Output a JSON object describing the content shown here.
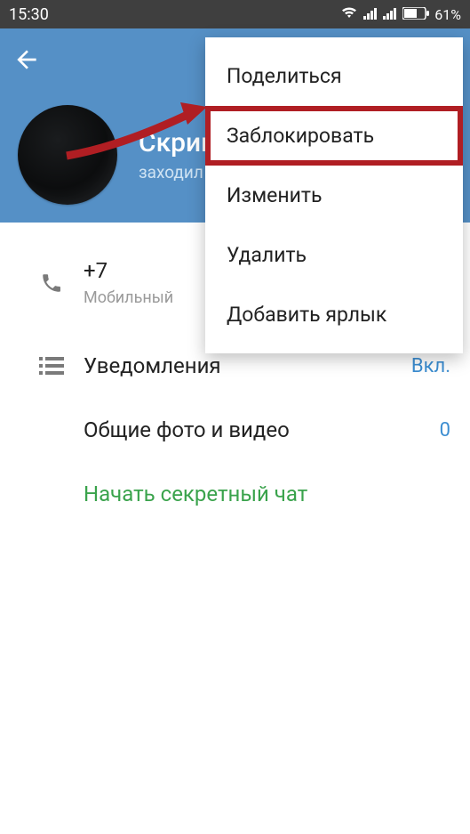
{
  "status_bar": {
    "time": "15:30",
    "battery": "61%"
  },
  "header": {
    "name": "Скрип",
    "last_seen": "заходил"
  },
  "phone": {
    "number": "+7",
    "type": "Мобильный"
  },
  "rows": {
    "notifications": {
      "label": "Уведомления",
      "value": "Вкл."
    },
    "shared_media": {
      "label": "Общие фото и видео",
      "value": "0"
    },
    "secret_chat": {
      "label": "Начать секретный чат"
    }
  },
  "menu": {
    "share": "Поделиться",
    "block": "Заблокировать",
    "edit": "Изменить",
    "delete": "Удалить",
    "add_shortcut": "Добавить ярлык"
  }
}
